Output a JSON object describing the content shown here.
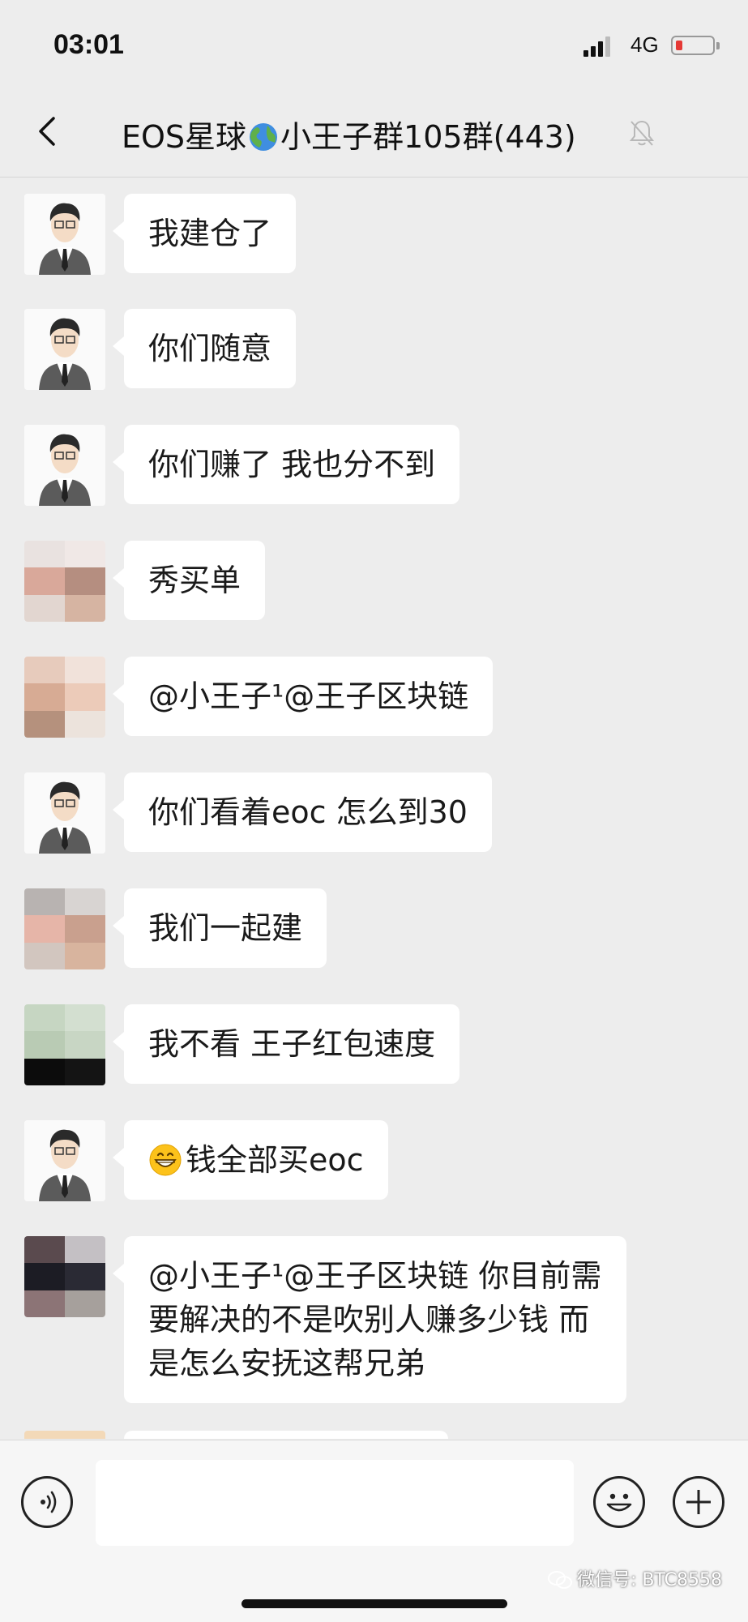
{
  "status_bar": {
    "time": "03:01",
    "network": "4G",
    "signal_icon": "signal-bars-icon",
    "battery_icon": "battery-low-icon",
    "battery_color": "#e53935"
  },
  "nav": {
    "back_icon": "chevron-left-icon",
    "title_prefix": "EOS星球",
    "title_suffix": "小王子群105群(443)",
    "globe_icon": "globe-emoji-icon",
    "mute_icon": "bell-muted-icon"
  },
  "messages": [
    {
      "avatar": "cartoon-man",
      "text": "我建仓了"
    },
    {
      "avatar": "cartoon-man",
      "text": "你们随意"
    },
    {
      "avatar": "cartoon-man",
      "text": "你们赚了 我也分不到"
    },
    {
      "avatar": "blurred-pink",
      "text": "秀买单"
    },
    {
      "avatar": "blurred-skin",
      "text": "@小王子¹@王子区块链"
    },
    {
      "avatar": "cartoon-man",
      "text": "你们看着eoc 怎么到30"
    },
    {
      "avatar": "blurred-grey-pink",
      "text": "我们一起建"
    },
    {
      "avatar": "blurred-green-black",
      "text": "我不看  王子红包速度"
    },
    {
      "avatar": "cartoon-man",
      "emoji": "grinning-face-icon",
      "text": "钱全部买eoc"
    },
    {
      "avatar": "blurred-dark",
      "text": "@小王子¹@王子区块链 你目前需要解决的不是吹别人赚多少钱 而是怎么安抚这帮兄弟"
    }
  ],
  "input_bar": {
    "voice_icon": "voice-input-icon",
    "emoji_icon": "emoji-smile-icon",
    "plus_icon": "plus-circle-icon",
    "input_value": ""
  },
  "watermark": {
    "text": "微信号: BTC8558",
    "icon": "wechat-logo-icon"
  }
}
